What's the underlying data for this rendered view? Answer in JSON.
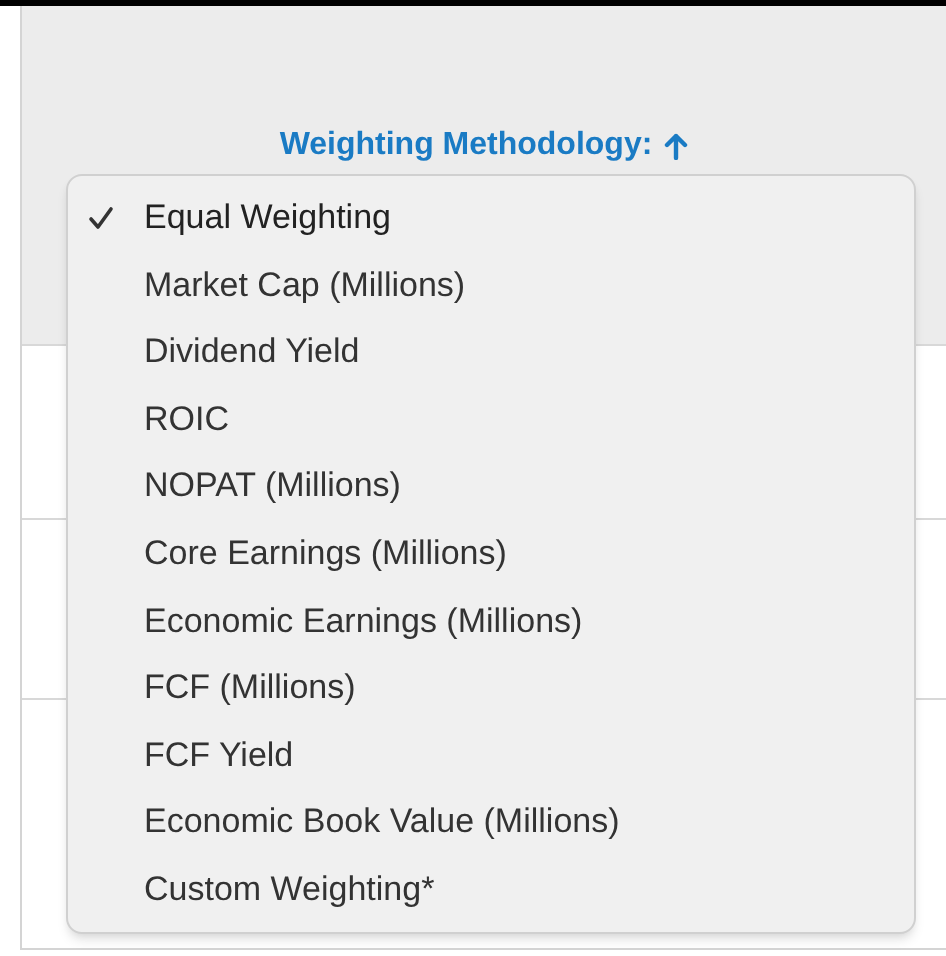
{
  "header": {
    "label": "Weighting Methodology:"
  },
  "menu": {
    "items": [
      {
        "label": "Equal Weighting",
        "selected": true
      },
      {
        "label": "Market Cap (Millions)",
        "selected": false
      },
      {
        "label": "Dividend Yield",
        "selected": false
      },
      {
        "label": "ROIC",
        "selected": false
      },
      {
        "label": "NOPAT (Millions)",
        "selected": false
      },
      {
        "label": "Core Earnings (Millions)",
        "selected": false
      },
      {
        "label": "Economic Earnings (Millions)",
        "selected": false
      },
      {
        "label": "FCF (Millions)",
        "selected": false
      },
      {
        "label": "FCF Yield",
        "selected": false
      },
      {
        "label": "Economic Book Value (Millions)",
        "selected": false
      },
      {
        "label": "Custom Weighting*",
        "selected": false
      }
    ]
  }
}
